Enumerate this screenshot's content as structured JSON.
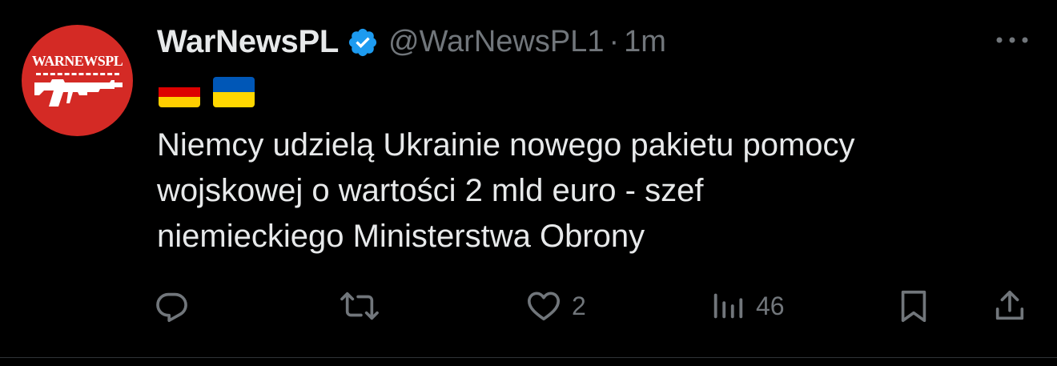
{
  "account": {
    "display_name": "WarNewsPL",
    "handle": "@WarNewsPL1",
    "separator": "·",
    "time": "1m",
    "avatar_text": "WARNEWSPL"
  },
  "tweet": {
    "lines": [
      "Niemcy udzielą Ukrainie nowego pakietu pomocy",
      "wojskowej o wartości 2 mld euro - szef",
      "niemieckiego Ministerstwa Obrony"
    ],
    "flags": [
      "germany-flag-icon",
      "ukraine-flag-icon"
    ]
  },
  "actions": {
    "reply": {
      "icon": "reply-icon",
      "count": ""
    },
    "repost": {
      "icon": "repost-icon",
      "count": ""
    },
    "like": {
      "icon": "heart-icon",
      "count": "2"
    },
    "views": {
      "icon": "views-icon",
      "count": "46"
    },
    "bookmark": {
      "icon": "bookmark-icon"
    },
    "share": {
      "icon": "share-icon"
    }
  },
  "colors": {
    "background": "#000000",
    "text": "#e7e9ea",
    "muted": "#71767b",
    "verified": "#1d9bf0",
    "avatar": "#d42a25"
  }
}
